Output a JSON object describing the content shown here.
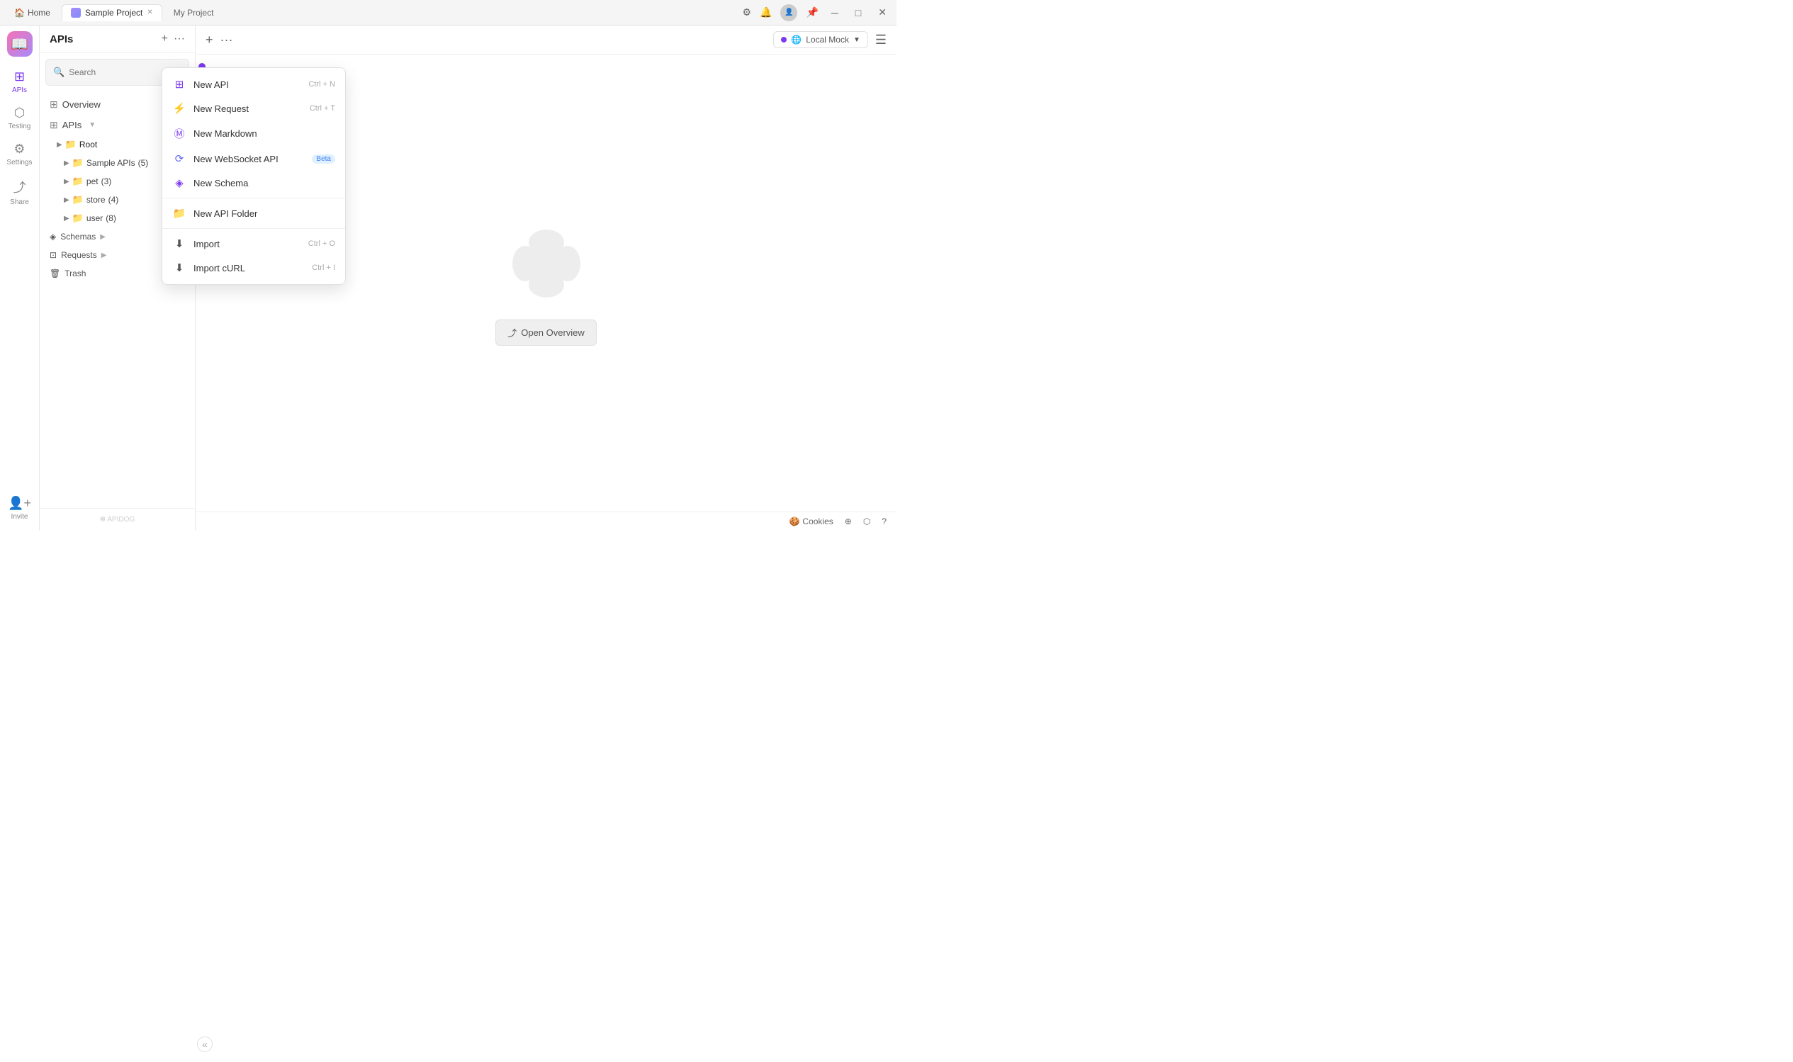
{
  "titlebar": {
    "home_label": "Home",
    "tab_active_label": "Sample Project",
    "tab_inactive_label": "My Project"
  },
  "toolbar": {
    "env_label": "Local Mock",
    "menu_icon": "☰"
  },
  "sidebar": {
    "title": "APIs",
    "search_placeholder": "Search",
    "icons": [
      {
        "id": "apis",
        "label": "APIs",
        "icon": "⊞"
      },
      {
        "id": "testing",
        "label": "Testing",
        "icon": "⬡"
      },
      {
        "id": "settings",
        "label": "Settings",
        "icon": "⚙"
      },
      {
        "id": "share",
        "label": "Share",
        "icon": "⤴"
      },
      {
        "id": "invite",
        "label": "Invite",
        "icon": "👤"
      }
    ],
    "nav": [
      {
        "id": "overview",
        "label": "Overview",
        "icon": "⊞"
      },
      {
        "id": "apis",
        "label": "APIs",
        "icon": "⊞",
        "has_arrow": true
      }
    ],
    "tree": {
      "root_label": "Root",
      "folders": [
        {
          "id": "sample-apis",
          "label": "Sample APIs",
          "count": 5
        },
        {
          "id": "pet",
          "label": "pet",
          "count": 3
        },
        {
          "id": "store",
          "label": "store",
          "count": 4
        },
        {
          "id": "user",
          "label": "user",
          "count": 8
        }
      ]
    },
    "schemas_label": "Schemas",
    "requests_label": "Requests",
    "trash_label": "Trash",
    "footer_logo": "✻ APIDOG"
  },
  "dropdown": {
    "items": [
      {
        "id": "new-api",
        "label": "New API",
        "icon": "⊞",
        "shortcut": "Ctrl + N",
        "icon_class": "icon-api"
      },
      {
        "id": "new-request",
        "label": "New Request",
        "icon": "⚡",
        "shortcut": "Ctrl + T",
        "icon_class": "icon-request"
      },
      {
        "id": "new-markdown",
        "label": "New Markdown",
        "icon": "Ⓜ",
        "shortcut": "",
        "icon_class": "icon-markdown"
      },
      {
        "id": "new-websocket",
        "label": "New WebSocket API",
        "icon": "⟳",
        "shortcut": "",
        "badge": "Beta",
        "icon_class": "icon-websocket"
      },
      {
        "id": "new-schema",
        "label": "New Schema",
        "icon": "◈",
        "shortcut": "",
        "icon_class": "icon-schema"
      },
      {
        "id": "new-folder",
        "label": "New API Folder",
        "icon": "📁",
        "shortcut": "",
        "icon_class": "icon-folder"
      },
      {
        "id": "import",
        "label": "Import",
        "icon": "⬇",
        "shortcut": "Ctrl + O",
        "icon_class": "icon-import"
      },
      {
        "id": "import-curl",
        "label": "Import cURL",
        "icon": "⬇",
        "shortcut": "Ctrl + I",
        "icon_class": "icon-import"
      }
    ]
  },
  "main": {
    "open_overview_label": "Open Overview"
  },
  "footer": {
    "cookies_label": "Cookies",
    "btn1": "⊕",
    "btn2": "⬡",
    "btn3": "?"
  }
}
